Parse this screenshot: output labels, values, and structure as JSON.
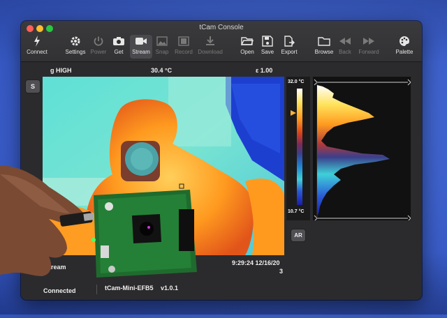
{
  "window": {
    "title": "tCam Console"
  },
  "toolbar": {
    "items": [
      {
        "label": "Connect",
        "icon": "plug-icon",
        "enabled": true
      },
      {
        "label": "Settings",
        "icon": "gear-icon",
        "enabled": true
      },
      {
        "label": "Power",
        "icon": "power-icon",
        "enabled": false
      },
      {
        "label": "Get",
        "icon": "camera-icon",
        "enabled": true
      },
      {
        "label": "Stream",
        "icon": "video-camera-icon",
        "enabled": true,
        "active": true
      },
      {
        "label": "Snap",
        "icon": "image-icon",
        "enabled": false
      },
      {
        "label": "Record",
        "icon": "film-icon",
        "enabled": false
      },
      {
        "label": "Download",
        "icon": "download-icon",
        "enabled": false
      },
      {
        "label": "Open",
        "icon": "folder-open-icon",
        "enabled": true
      },
      {
        "label": "Save",
        "icon": "floppy-disk-icon",
        "enabled": true
      },
      {
        "label": "Export",
        "icon": "export-icon",
        "enabled": true
      },
      {
        "label": "Browse",
        "icon": "folder-icon",
        "enabled": true
      },
      {
        "label": "Back",
        "icon": "rewind-icon",
        "enabled": false
      },
      {
        "label": "Forward",
        "icon": "fast-forward-icon",
        "enabled": false
      },
      {
        "label": "Palette",
        "icon": "palette-icon",
        "enabled": true
      }
    ]
  },
  "status_row": {
    "gain": "g HIGH",
    "spot_temp": "30.4 °C",
    "emissivity": "ε 1.00"
  },
  "snap_button": {
    "label": "S"
  },
  "colorbar": {
    "max_label": "32.0 °C",
    "min_label": "10.7 °C"
  },
  "ar_button": {
    "label": "AR"
  },
  "image_info": {
    "mode": "Stream",
    "timestamp_line1": "9:29:24 12/16/20",
    "timestamp_line2": "3"
  },
  "status_bar": {
    "connection": "Connected",
    "device": "tCam-Mini-EFB5",
    "version": "v1.0.1"
  },
  "colors": {
    "window_bg": "#2b2b2d",
    "toolbar_text": "#e6e6e6",
    "disabled_text": "#7a7a7a",
    "desk_blue": "#3f63cf"
  }
}
